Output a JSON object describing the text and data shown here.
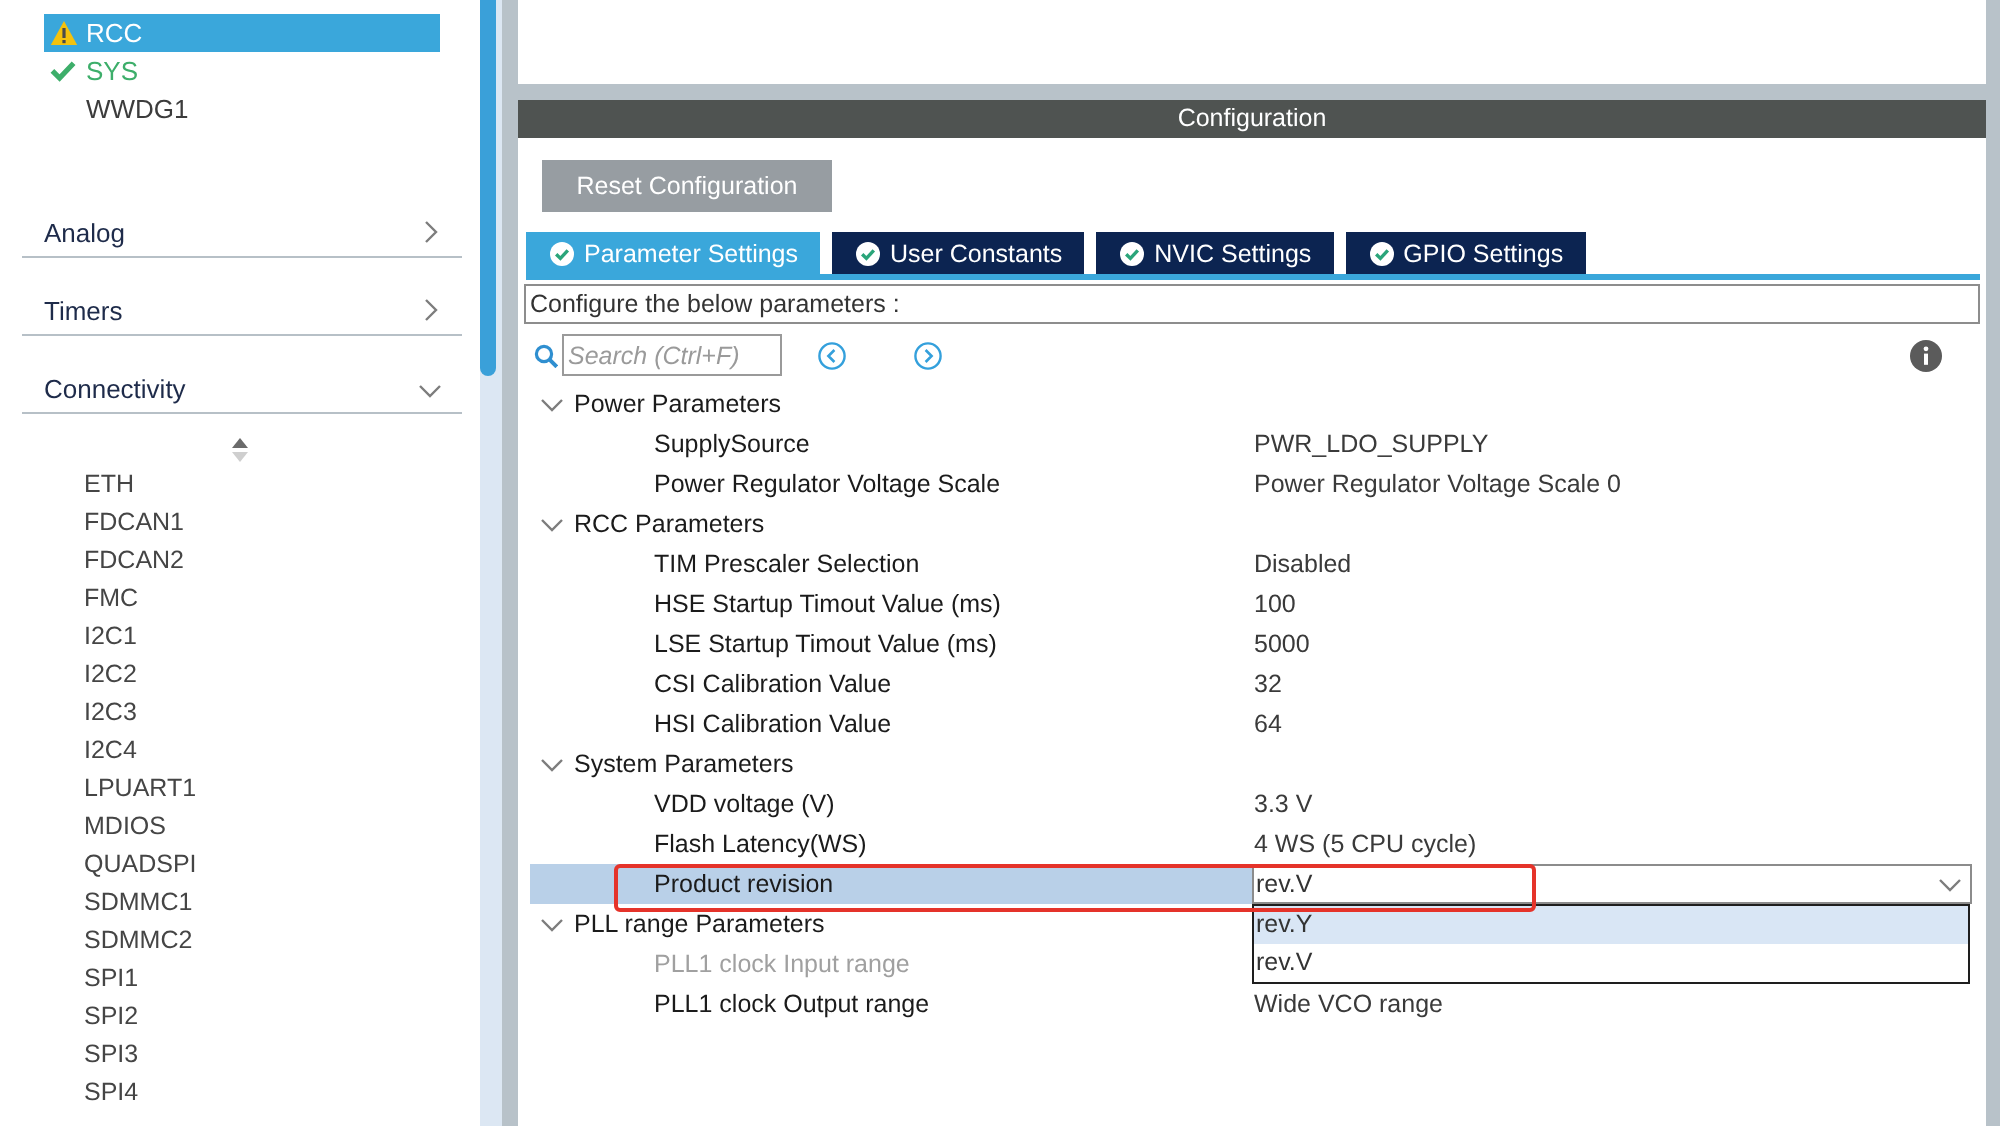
{
  "sidebar": {
    "peripherals": [
      {
        "label": "RCC",
        "kind": "warning",
        "selected": true
      },
      {
        "label": "SYS",
        "kind": "ok",
        "selected": false
      },
      {
        "label": "WWDG1",
        "kind": "plain",
        "selected": false
      }
    ],
    "categories": [
      {
        "label": "Analog",
        "expanded": false
      },
      {
        "label": "Timers",
        "expanded": false
      },
      {
        "label": "Connectivity",
        "expanded": true,
        "items": [
          "ETH",
          "FDCAN1",
          "FDCAN2",
          "FMC",
          "I2C1",
          "I2C2",
          "I2C3",
          "I2C4",
          "LPUART1",
          "MDIOS",
          "QUADSPI",
          "SDMMC1",
          "SDMMC2",
          "SPI1",
          "SPI2",
          "SPI3",
          "SPI4"
        ]
      }
    ]
  },
  "configuration": {
    "title": "Configuration",
    "reset_button": "Reset Configuration",
    "tabs": [
      {
        "label": "Parameter Settings",
        "selected": true
      },
      {
        "label": "User Constants",
        "selected": false
      },
      {
        "label": "NVIC Settings",
        "selected": false
      },
      {
        "label": "GPIO Settings",
        "selected": false
      }
    ],
    "hint": "Configure the below parameters :",
    "search": {
      "placeholder": "Search (Ctrl+F)"
    },
    "groups": [
      {
        "label": "Power Parameters",
        "expanded": true,
        "children": [
          {
            "name": "SupplySource",
            "value": "PWR_LDO_SUPPLY",
            "kind": "text",
            "selected": false,
            "disabled": false,
            "marked": false
          },
          {
            "name": "Power Regulator Voltage Scale",
            "value": "Power Regulator Voltage Scale 0",
            "kind": "text",
            "selected": false,
            "disabled": false,
            "marked": false
          }
        ]
      },
      {
        "label": "RCC Parameters",
        "expanded": true,
        "children": [
          {
            "name": "TIM Prescaler Selection",
            "value": "Disabled",
            "kind": "text",
            "selected": false,
            "disabled": false,
            "marked": false
          },
          {
            "name": "HSE Startup Timout Value (ms)",
            "value": "100",
            "kind": "text",
            "selected": false,
            "disabled": false,
            "marked": false
          },
          {
            "name": "LSE Startup Timout Value (ms)",
            "value": "5000",
            "kind": "text",
            "selected": false,
            "disabled": false,
            "marked": false
          },
          {
            "name": "CSI Calibration Value",
            "value": "32",
            "kind": "text",
            "selected": false,
            "disabled": false,
            "marked": false
          },
          {
            "name": "HSI Calibration Value",
            "value": "64",
            "kind": "text",
            "selected": false,
            "disabled": false,
            "marked": false
          }
        ]
      },
      {
        "label": "System Parameters",
        "expanded": true,
        "children": [
          {
            "name": "VDD voltage (V)",
            "value": "3.3 V",
            "kind": "text",
            "selected": false,
            "disabled": false,
            "marked": false
          },
          {
            "name": "Flash Latency(WS)",
            "value": "4 WS (5 CPU cycle)",
            "kind": "text",
            "selected": false,
            "disabled": false,
            "marked": false
          },
          {
            "name": "Product revision",
            "value": "rev.V",
            "kind": "dropdown",
            "expanded": true,
            "options": [
              {
                "label": "rev.Y",
                "highlighted": true
              },
              {
                "label": "rev.V",
                "highlighted": false
              }
            ],
            "selected": true,
            "disabled": false,
            "marked": true
          }
        ]
      },
      {
        "label": "PLL range Parameters",
        "expanded": true,
        "children": [
          {
            "name": "PLL1 clock Input range",
            "kind": "text",
            "selected": false,
            "disabled": true,
            "marked": false
          },
          {
            "name": "PLL1 clock Output range",
            "value": "Wide VCO range",
            "kind": "text",
            "selected": false,
            "disabled": false,
            "marked": false
          }
        ]
      }
    ]
  }
}
